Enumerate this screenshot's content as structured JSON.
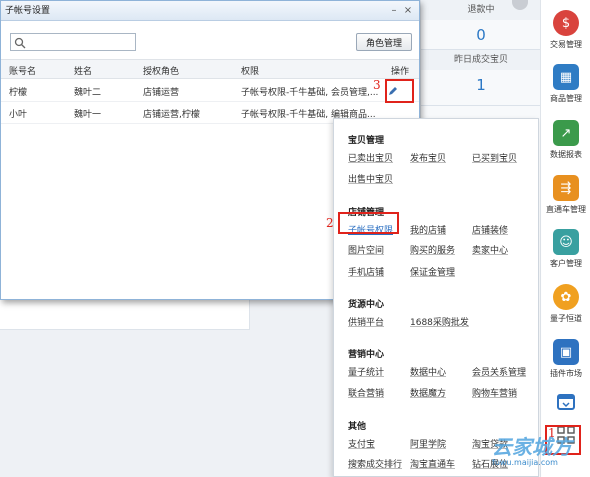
{
  "dialog": {
    "title": "子帐号设置",
    "min_glyph": "–",
    "close_glyph": "×",
    "search": {
      "value": "",
      "placeholder": ""
    },
    "role_button": "角色管理",
    "columns": [
      "账号名",
      "姓名",
      "授权角色",
      "权限",
      "操作"
    ],
    "rows": [
      {
        "account": "柠檬",
        "name": "魏叶二",
        "role": "店铺运营",
        "permission": "子帐号权限-千牛基础, 会员管理,..."
      },
      {
        "account": "小叶",
        "name": "魏叶一",
        "role": "店铺运营,柠檬",
        "permission": "子帐号权限-千牛基础, 编辑商品..."
      }
    ]
  },
  "markers": {
    "one": "1",
    "two": "2",
    "three": "3"
  },
  "stats": {
    "refund_label": "退款中",
    "refund_value": "0",
    "yesterday_label": "昨日成交宝贝",
    "yesterday_value": "1"
  },
  "menu": {
    "sections": [
      {
        "title": "宝贝管理",
        "links": [
          "已卖出宝贝",
          "发布宝贝",
          "已买到宝贝",
          "出售中宝贝"
        ]
      },
      {
        "title": "店铺管理",
        "links": [
          "子帐号权限",
          "我的店铺",
          "店铺装修",
          "图片空间",
          "购买的服务",
          "卖家中心",
          "手机店铺",
          "保证金管理"
        ]
      },
      {
        "title": "货源中心",
        "links": [
          "供销平台",
          "1688采购批发"
        ]
      },
      {
        "title": "营销中心",
        "links": [
          "量子统计",
          "数据中心",
          "会员关系管理",
          "联合营销",
          "数据魔方",
          "购物车营销"
        ]
      },
      {
        "title": "其他",
        "links": [
          "支付宝",
          "阿里学院",
          "淘宝贷款",
          "搜索成交排行",
          "淘宝直通车",
          "钻石展位"
        ]
      }
    ]
  },
  "toolbar": [
    {
      "label": "交易管理",
      "icon": "dollar-icon",
      "color": "#d9433d",
      "glyph": "$"
    },
    {
      "label": "商品管理",
      "icon": "goods-icon",
      "color": "#2f7cc4",
      "glyph": "▦"
    },
    {
      "label": "数据报表",
      "icon": "chart-icon",
      "color": "#3b9a4b",
      "glyph": "↗"
    },
    {
      "label": "直通车管理",
      "icon": "car-icon",
      "color": "#e8901f",
      "glyph": "⇶"
    },
    {
      "label": "客户管理",
      "icon": "user-icon",
      "color": "#39a0a0",
      "glyph": "☺"
    },
    {
      "label": "量子恒道",
      "icon": "quantum-icon",
      "color": "#f0a020",
      "glyph": "✿"
    },
    {
      "label": "插件市场",
      "icon": "plugin-icon",
      "color": "#2e72c0",
      "glyph": "▣"
    }
  ],
  "watermark": {
    "big": "云家城方",
    "small": "fuwu.maijia.com"
  }
}
